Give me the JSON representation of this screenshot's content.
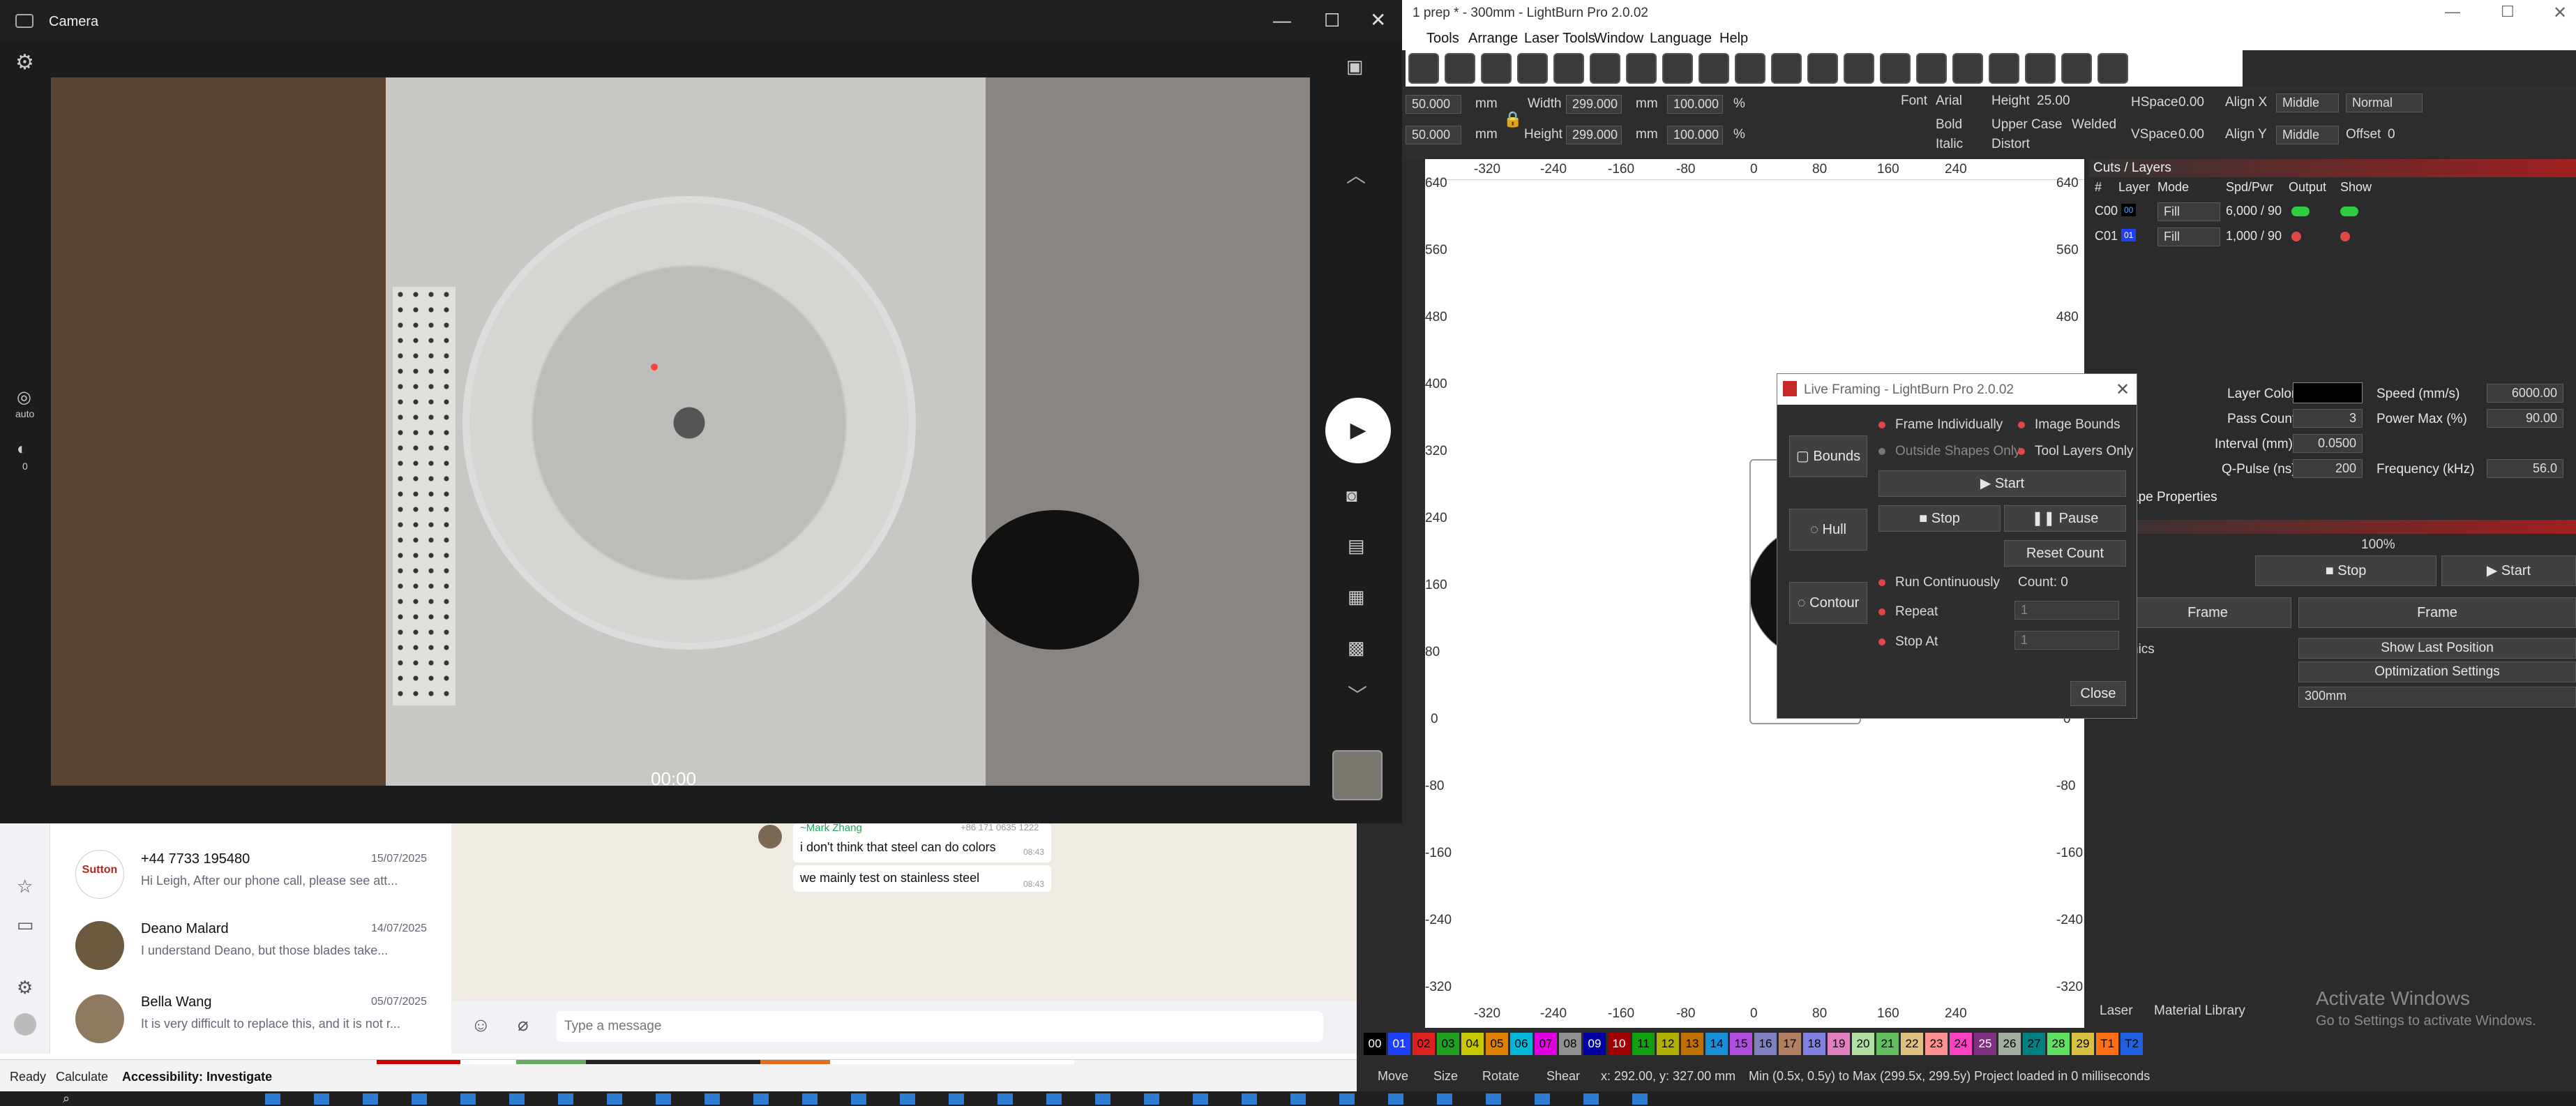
{
  "camera": {
    "title": "Camera",
    "timer": "00:00",
    "auto_label": "auto",
    "zero_label": "0"
  },
  "lightburn": {
    "title": "1 prep * - 300mm - LightBurn Pro 2.0.02",
    "menu": [
      "Tools",
      "Arrange",
      "Laser Tools",
      "Window",
      "Language",
      "Help"
    ],
    "pos_x": "50.000",
    "pos_y": "50.000",
    "unit": "mm",
    "width_label": "Width",
    "width": "299.000",
    "height_label": "Height",
    "height": "299.000",
    "pct_w": "100.000",
    "pct_h": "100.000",
    "pct": "%",
    "font_label": "Font",
    "font": "Arial",
    "height_txt_label": "Height",
    "height_txt": "25.00",
    "hspace_label": "HSpace",
    "hspace": "0.00",
    "vspace_label": "VSpace",
    "vspace": "0.00",
    "align_x_label": "Align X",
    "align_x": "Middle",
    "align_y_label": "Align Y",
    "align_y": "Middle",
    "normal": "Normal",
    "offset_label": "Offset",
    "offset": "0",
    "bold": "Bold",
    "upper": "Upper Case",
    "welded": "Welded",
    "italic": "Italic",
    "distort": "Distort",
    "ruler_top": [
      "-320",
      "-240",
      "-160",
      "-80",
      "0",
      "80",
      "160",
      "240"
    ],
    "ruler_left": [
      "640",
      "560",
      "480",
      "400",
      "320",
      "240",
      "160",
      "80",
      "0",
      "-80",
      "-160",
      "-240",
      "-320"
    ],
    "ruler_right": [
      "640",
      "560",
      "480",
      "400",
      "320",
      "240",
      "160",
      "80",
      "0",
      "-80",
      "-160",
      "-240",
      "-320"
    ],
    "cuts": {
      "title": "Cuts / Layers",
      "headers": [
        "#",
        "Layer",
        "Mode",
        "Spd/Pwr",
        "Output",
        "Show"
      ],
      "rows": [
        {
          "id": "C00",
          "layer": "00",
          "mode": "Fill",
          "spdpwr": "6,000 / 90"
        },
        {
          "id": "C01",
          "layer": "01",
          "mode": "Fill",
          "spdpwr": "1,000 / 90"
        }
      ]
    },
    "props": {
      "layer_color": "Layer Color",
      "speed_label": "Speed (mm/s)",
      "speed": "6000.00",
      "pass_label": "Pass Count",
      "pass": "3",
      "power_label": "Power Max (%)",
      "power": "90.00",
      "interval_label": "Interval (mm)",
      "interval": "0.0500",
      "qpulse_label": "Q-Pulse (ns)",
      "qpulse": "200",
      "freq_label": "Frequency (kHz)",
      "freq": "56.0",
      "shape_props": "ape Properties"
    },
    "laser": {
      "pct": "100%",
      "stop": "Stop",
      "start": "Start",
      "frame1": "Frame",
      "frame2": "Frame",
      "nics": "nics",
      "show_last": "Show Last Position",
      "opt": "Optimization Settings",
      "device": "300mm"
    },
    "tabs": [
      "Laser",
      "Material Library"
    ],
    "palette": [
      "00",
      "01",
      "02",
      "03",
      "04",
      "05",
      "06",
      "07",
      "08",
      "09",
      "10",
      "11",
      "12",
      "13",
      "14",
      "15",
      "16",
      "17",
      "18",
      "19",
      "20",
      "21",
      "22",
      "23",
      "24",
      "25",
      "26",
      "27",
      "28",
      "29",
      "T1",
      "T2"
    ],
    "palette_colors": [
      "#000000",
      "#1f3fff",
      "#e02020",
      "#20a020",
      "#c8c800",
      "#e08000",
      "#00b8d8",
      "#e000e0",
      "#909090",
      "#0000a0",
      "#a00000",
      "#10a010",
      "#b0b000",
      "#c07000",
      "#1a8fd8",
      "#b04ce0",
      "#8080c0",
      "#b08060",
      "#8080e0",
      "#e080c0",
      "#b0e0a0",
      "#60c060",
      "#e0c080",
      "#ff9090",
      "#ff40c0",
      "#803080",
      "#a0b0a0",
      "#008080",
      "#60e060",
      "#d8c040",
      "#ff7010",
      "#2060e0"
    ],
    "status": {
      "move": "Move",
      "size": "Size",
      "rotate": "Rotate",
      "shear": "Shear",
      "coords": "x: 292.00, y: 327.00 mm",
      "range": "Min (0.5x, 0.5y) to Max (299.5x, 299.5y)  Project loaded in 0 milliseconds"
    }
  },
  "live": {
    "title": "Live Framing - LightBurn Pro 2.0.02",
    "bounds": "Bounds",
    "hull": "Hull",
    "contour": "Contour",
    "frame_ind": "Frame Individually",
    "image_bounds": "Image Bounds",
    "outside": "Outside Shapes Only",
    "tool_only": "Tool Layers Only",
    "start": "Start",
    "stop": "Stop",
    "pause": "Pause",
    "reset": "Reset Count",
    "run": "Run Continuously",
    "count": "Count: 0",
    "repeat": "Repeat",
    "repeat_val": "1",
    "stop_at": "Stop At",
    "stop_at_val": "1",
    "close": "Close"
  },
  "whatsapp": {
    "chats": [
      {
        "name": "+44 7733 195480",
        "date": "15/07/2025",
        "msg": "Hi Leigh, After our phone call, please see att..."
      },
      {
        "name": "Deano Malard",
        "date": "14/07/2025",
        "msg": "I understand Deano, but those blades take..."
      },
      {
        "name": "Bella Wang",
        "date": "05/07/2025",
        "msg": "It is very difficult to replace this, and it is not r..."
      }
    ],
    "sender": "~Mark Zhang",
    "sender_num": "+86 171 0635 1222",
    "messages": [
      {
        "text": "i don't think that steel can do colors",
        "time": "08:43"
      },
      {
        "text": "we mainly test on stainless steel",
        "time": "08:43"
      }
    ],
    "input_placeholder": "Type a message"
  },
  "excel": {
    "ready": "Ready",
    "calculate": "Calculate",
    "access": "Accessibility: Investigate"
  },
  "watermark": {
    "line1": "Activate Windows",
    "line2": "Go to Settings to activate Windows."
  }
}
